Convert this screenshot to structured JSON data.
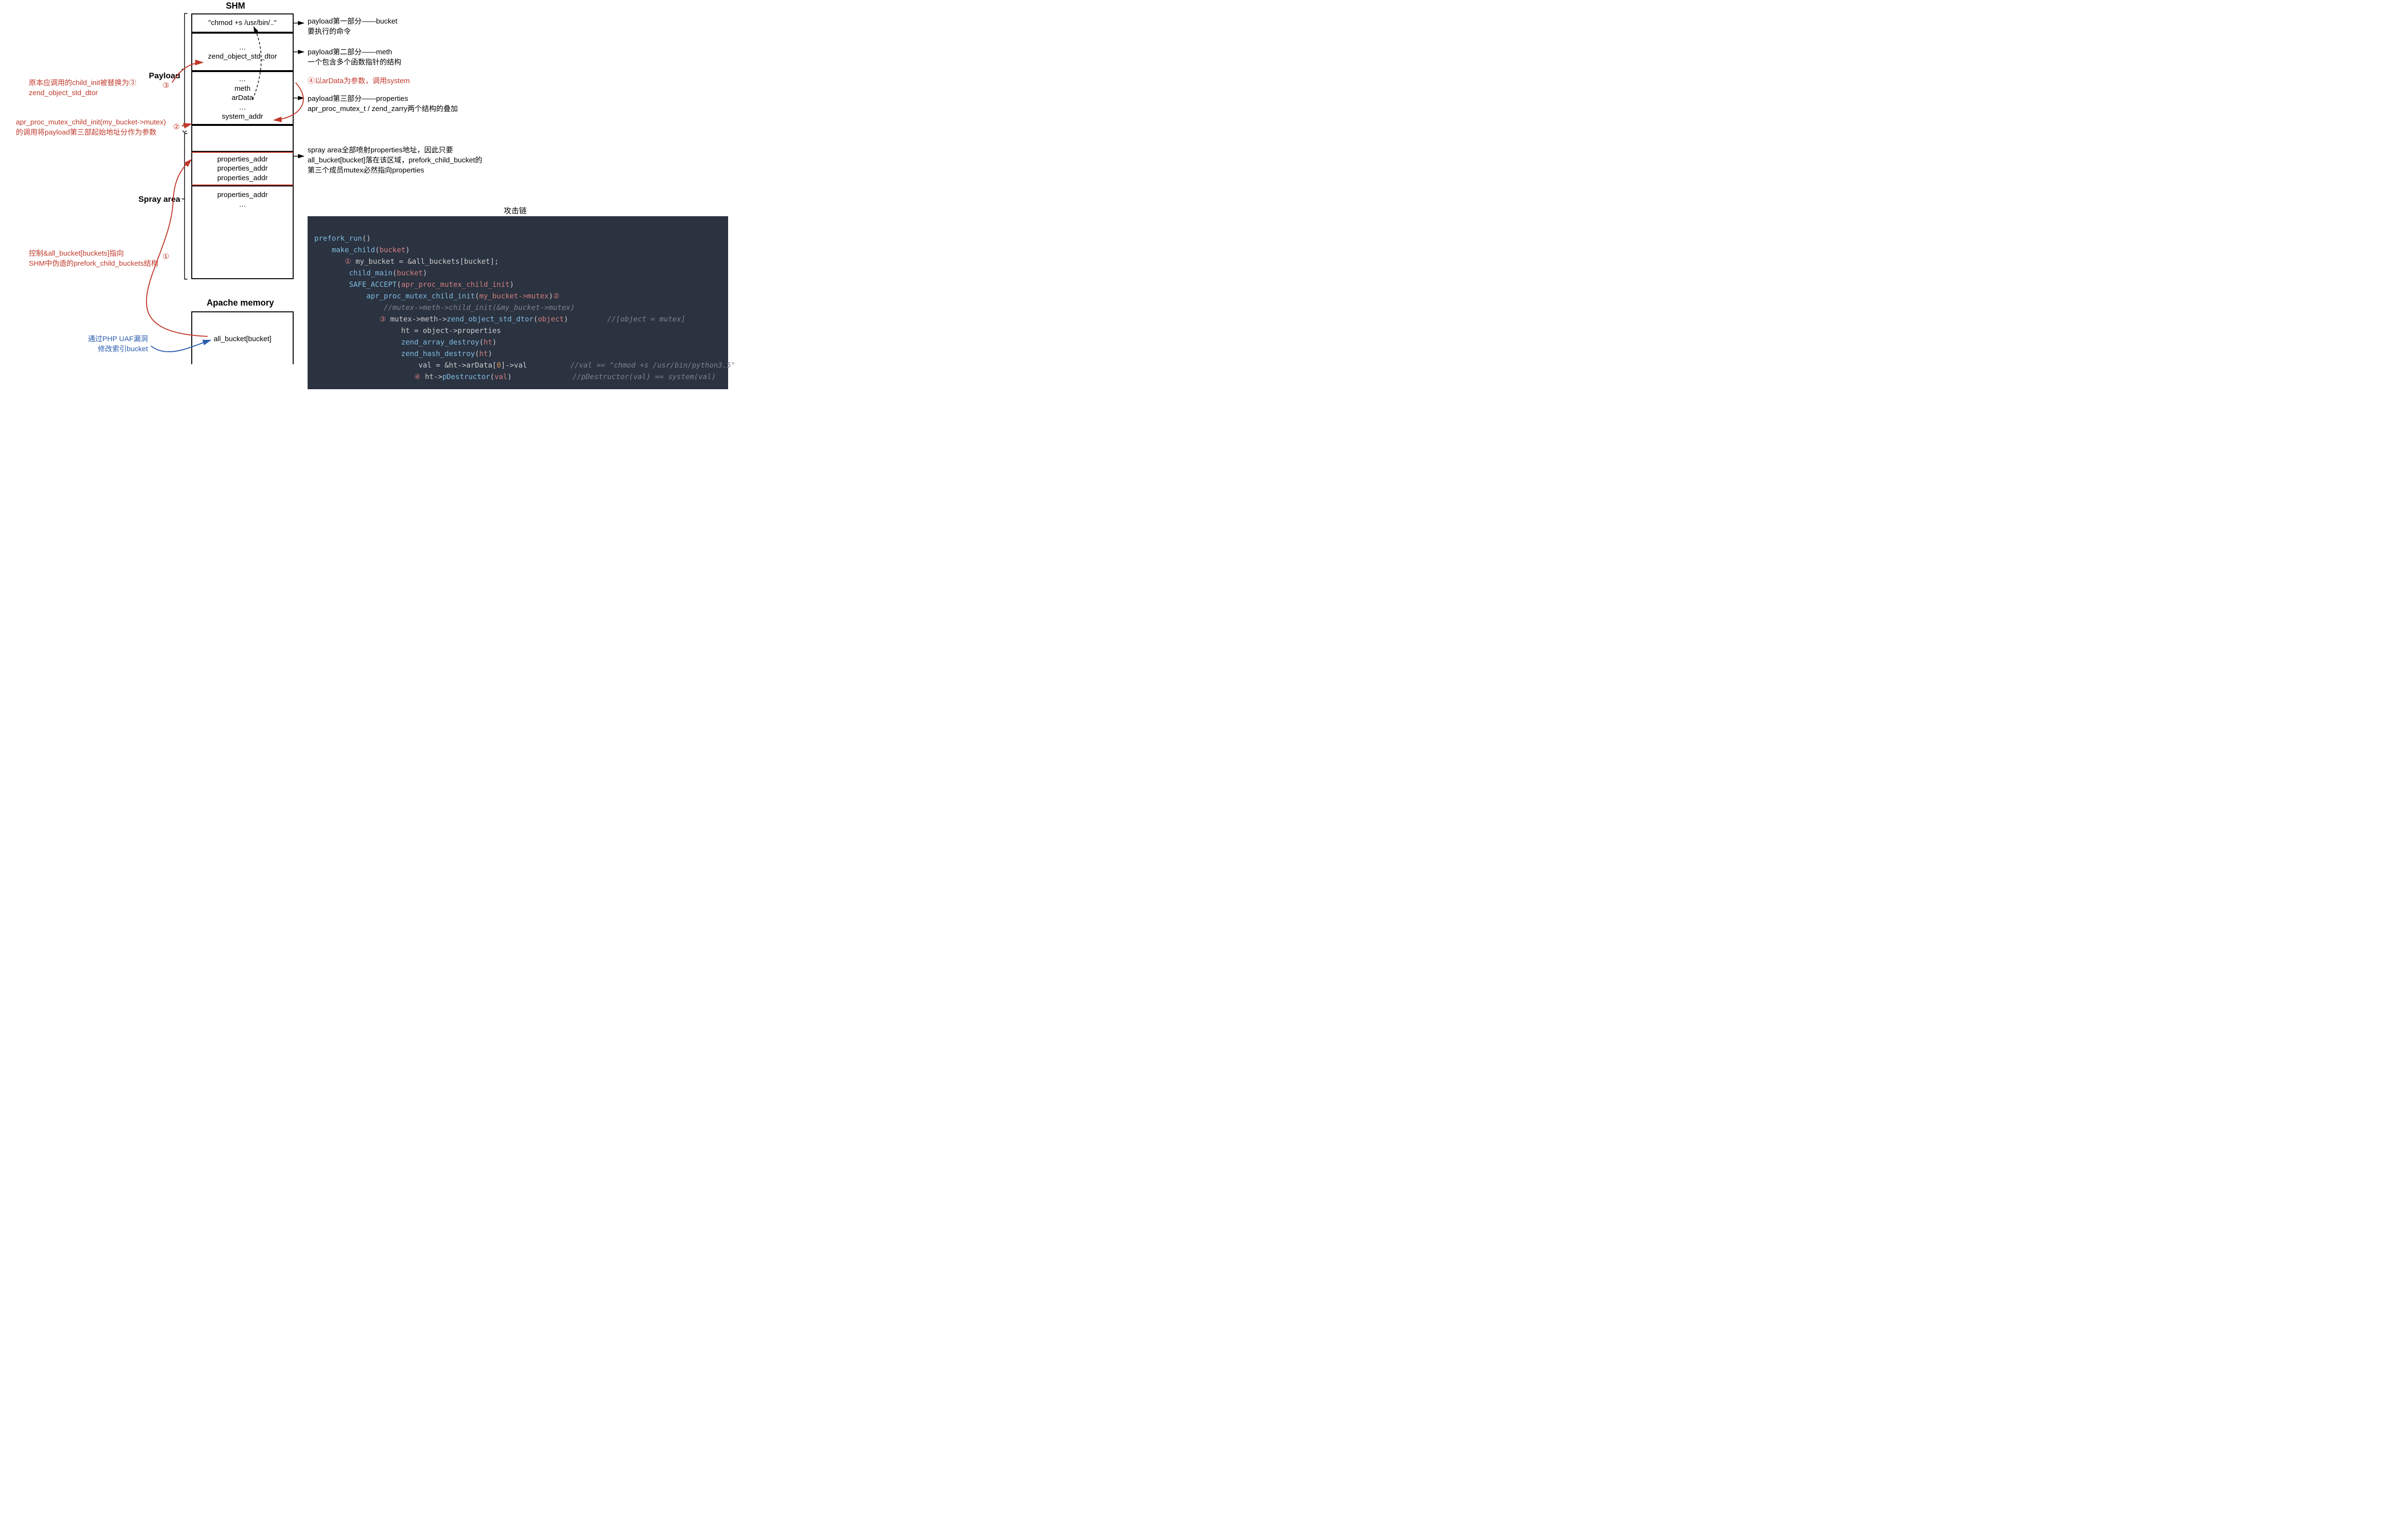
{
  "titles": {
    "shm": "SHM",
    "apache": "Apache memory",
    "payload": "Payload",
    "spray": "Spray area",
    "chain": "攻击链"
  },
  "cells": {
    "bucket_cmd": "\"chmod +s /usr/bin/..\"",
    "dots1": "…",
    "zend_dtor": "zend_object_std_dtor",
    "dots2": "…",
    "meth": "meth",
    "arData": "arData",
    "dots3": "…",
    "system_addr": "system_addr",
    "props1": "properties_addr",
    "props2": "properties_addr",
    "props3": "properties_addr",
    "props4": "properties_addr",
    "dots4": "…",
    "all_bucket": "all_bucket[bucket]"
  },
  "desc": {
    "p1_a": "payload第一部分——bucket",
    "p1_b": "要执行的命令",
    "p2_a": "payload第二部分——meth",
    "p2_b": "一个包含多个函数指针的结构",
    "p3_a": "payload第三部分——properties",
    "p3_b": "apr_proc_mutex_t / zend_zarry两个结构的叠加",
    "sp_a": "spray area全部喷射properties地址，因此只要",
    "sp_b": "all_bucket[bucket]落在该区域，prefork_child_bucket的",
    "sp_c": "第三个成员mutex必然指向properties"
  },
  "red": {
    "r3_a": "原本应调用的child_init被替换为③",
    "r3_b": "zend_object_std_dtor",
    "r4": "④以arData为参数，调用system",
    "r2_a": "apr_proc_mutex_child_init(my_bucket->mutex)",
    "r2_b": "的调用将payload第三部起始地址分作为参数",
    "r1_a": "控制&all_bucket[buckets]指向",
    "r1_b": "SHM中伪造的prefork_child_buckets结构"
  },
  "blue": {
    "uaf_a": "通过PHP UAF漏洞",
    "uaf_b": "修改索引bucket"
  },
  "circles": {
    "c1": "①",
    "c2": "②",
    "c3": "③",
    "c4": "④"
  },
  "code": {
    "l01a": "prefork_run",
    "l01b": "()",
    "l02a": "make_child",
    "l02b": "(",
    "l02c": "bucket",
    "l02d": ")",
    "l03m": "①",
    "l03a": " my_bucket = &all_buckets[bucket];",
    "l04a": "child_main",
    "l04b": "(",
    "l04c": "bucket",
    "l04d": ")",
    "l05a": "SAFE_ACCEPT",
    "l05b": "(",
    "l05c": "apr_proc_mutex_child_init",
    "l05d": ")",
    "l06a": "apr_proc_mutex_child_init",
    "l06b": "(",
    "l06c": "my_bucket->mutex",
    "l06d": ")",
    "l06m": "②",
    "l07": "//mutex->meth->child_init(&my_bucket->mutex)",
    "l08m": "③",
    "l08a": " mutex->meth->",
    "l08b": "zend_object_std_dtor",
    "l08c": "(",
    "l08d": "object",
    "l08e": ")",
    "l08cmt": "//[object = mutex]",
    "l09": "ht = object->properties",
    "l10a": "zend_array_destroy",
    "l10b": "(",
    "l10c": "ht",
    "l10d": ")",
    "l11a": "zend_hash_destroy",
    "l11b": "(",
    "l11c": "ht",
    "l11d": ")",
    "l12a": "val = &ht->arData[",
    "l12b": "0",
    "l12c": "]->val",
    "l12cmt": "//val == \"chmod +s /usr/bin/python3.5\"",
    "l13m": "④",
    "l13a": " ht->",
    "l13b": "pDestructor",
    "l13c": "(",
    "l13d": "val",
    "l13e": ")",
    "l13cmt": "//pDestructor(val) == system(val)"
  }
}
